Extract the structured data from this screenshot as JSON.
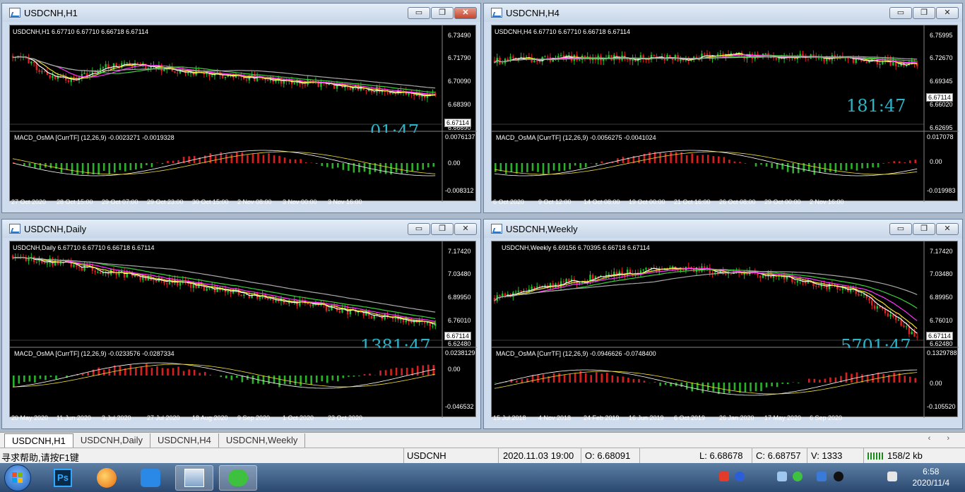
{
  "windows": [
    {
      "id": "h1",
      "title": "USDCNH,H1",
      "info": "USDCNH,H1  6.67710 6.67710 6.66718 6.67114",
      "price_ticks": [
        "6.73490",
        "6.71790",
        "6.70090",
        "6.68390",
        "6.66690"
      ],
      "macd_ticks": [
        "0.0076137",
        "0.00",
        "-0.008312"
      ],
      "macd_label": "MACD_OsMA [CurrTF] (12,26,9) -0.0023271 -0.0019328",
      "time_labels": [
        "27 Oct 2020",
        "28 Oct 15:00",
        "29 Oct 07:00",
        "29 Oct 23:00",
        "30 Oct 15:00",
        "2 Nov 08:00",
        "3 Nov 00:00",
        "3 Nov 16:00"
      ],
      "price_tag": "6.67114",
      "timer": "01:47"
    },
    {
      "id": "h4",
      "title": "USDCNH,H4",
      "info": "USDCNH,H4  6.67710 6.67710 6.66718 6.67114",
      "price_ticks": [
        "6.75995",
        "6.72670",
        "6.69345",
        "6.66020",
        "6.62695"
      ],
      "macd_ticks": [
        "0.017078",
        "0.00",
        "-0.019983"
      ],
      "macd_label": "MACD_OsMA [CurrTF] (12,26,9) -0.0056275 -0.0041024",
      "time_labels": [
        "6 Oct 2020",
        "9 Oct 12:00",
        "14 Oct 08:00",
        "19 Oct 00:00",
        "21 Oct 16:00",
        "26 Oct 08:00",
        "29 Oct 00:00",
        "2 Nov 16:00"
      ],
      "price_tag": "6.67114",
      "timer": "181:47"
    },
    {
      "id": "d1",
      "title": "USDCNH,Daily",
      "info": "USDCNH,Daily  6.67710 6.67710 6.66718 6.67114",
      "price_ticks": [
        "7.17420",
        "7.03480",
        "6.89950",
        "6.76010",
        "6.62480"
      ],
      "macd_ticks": [
        "0.0238129",
        "0.00",
        "-0.046532"
      ],
      "macd_label": "MACD_OsMA [CurrTF] (12,26,9) -0.0233576 -0.0287334",
      "time_labels": [
        "20 May 2020",
        "11 Jun 2020",
        "3 Jul 2020",
        "27 Jul 2020",
        "18 Aug 2020",
        "9 Sep 2020",
        "1 Oct 2020",
        "23 Oct 2020"
      ],
      "price_tag": "6.67114",
      "timer": "1381:47"
    },
    {
      "id": "w1",
      "title": "USDCNH,Weekly",
      "info": "USDCNH,Weekly  6.69156 6.70395 6.66718 6.67114",
      "price_ticks": [
        "7.17420",
        "7.03480",
        "6.89950",
        "6.76010",
        "6.62480"
      ],
      "macd_ticks": [
        "0.1329788",
        "0.00",
        "-0.105520"
      ],
      "macd_label": "MACD_OsMA [CurrTF] (12,26,9) -0.0946626 -0.0748400",
      "time_labels": [
        "15 Jul 2018",
        "4 Nov 2018",
        "24 Feb 2019",
        "16 Jun 2019",
        "6 Oct 2019",
        "26 Jan 2020",
        "17 May 2020",
        "6 Sep 2020"
      ],
      "price_tag": "6.67114",
      "timer": "5701:47"
    }
  ],
  "window_buttons": {
    "min": "▭",
    "max": "❐",
    "close": "✕"
  },
  "tabs": [
    "USDCNH,H1",
    "USDCNH,Daily",
    "USDCNH,H4",
    "USDCNH,Weekly"
  ],
  "tab_nav": "‹ ›",
  "status": {
    "help": "寻求帮助,请按F1键",
    "symbol": "USDCNH",
    "time": "2020.11.03 19:00",
    "open": "O: 6.68091",
    "low": "L: 6.68678",
    "close": "C: 6.68757",
    "volume": "V: 1333",
    "traffic": "158/2 kb"
  },
  "clock": {
    "time": "6:58",
    "date": "2020/11/4"
  },
  "taskbar_apps": [
    "Ps",
    "fox",
    "bird",
    "mt4",
    "wechat"
  ],
  "colors": {
    "up": "#22c02a",
    "down": "#e02020",
    "white": "#ffffff",
    "yellow": "#f2e233",
    "magenta": "#ff33ff",
    "green_ma": "#3bcf3b",
    "gray_ma": "#a8a8a8"
  }
}
